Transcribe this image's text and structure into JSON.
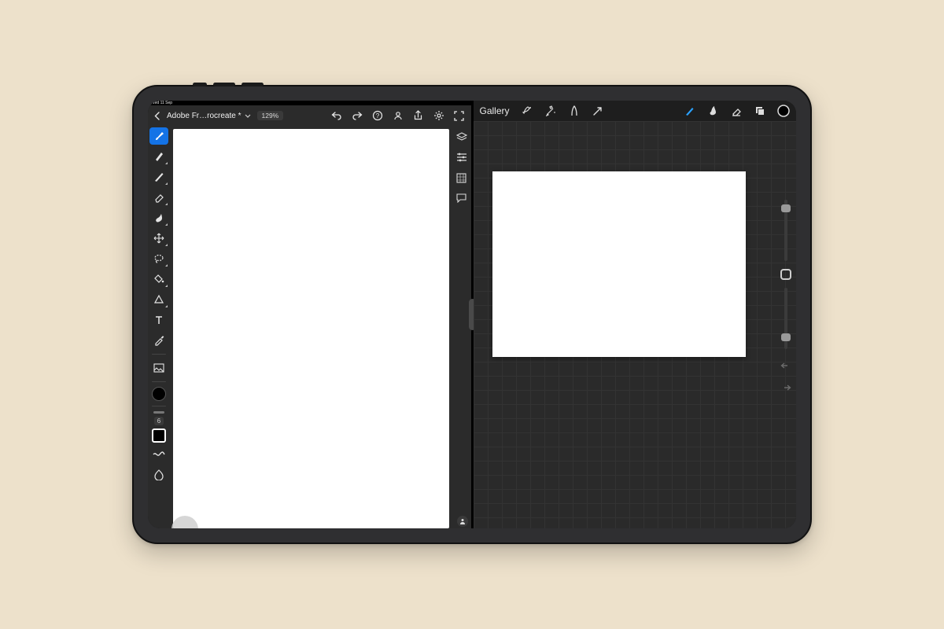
{
  "statusbar": {
    "text": "Wed 11 Sep"
  },
  "fresco": {
    "document_name": "Adobe Fr…rocreate *",
    "zoom": "129%",
    "tools": [
      {
        "id": "pixel-brush",
        "active": true,
        "hasSub": false
      },
      {
        "id": "live-brush",
        "active": false,
        "hasSub": true
      },
      {
        "id": "vector-brush",
        "active": false,
        "hasSub": true
      },
      {
        "id": "eraser",
        "active": false,
        "hasSub": true
      },
      {
        "id": "smudge",
        "active": false,
        "hasSub": true
      },
      {
        "id": "move",
        "active": false,
        "hasSub": true
      },
      {
        "id": "lasso",
        "active": false,
        "hasSub": true
      },
      {
        "id": "fill",
        "active": false,
        "hasSub": true
      },
      {
        "id": "shape",
        "active": false,
        "hasSub": true
      },
      {
        "id": "text",
        "active": false,
        "hasSub": false
      },
      {
        "id": "eyedropper",
        "active": false,
        "hasSub": false
      },
      {
        "id": "place-image",
        "active": false,
        "hasSub": false
      }
    ],
    "brush_size": "6",
    "foreground": "#000000",
    "right_panels": [
      "layers",
      "adjust",
      "precision",
      "comments"
    ],
    "top_actions": [
      "undo",
      "redo",
      "help",
      "invite",
      "share",
      "settings",
      "fullscreen"
    ]
  },
  "procreate": {
    "gallery_label": "Gallery",
    "top_left_actions": [
      "actions",
      "adjustments",
      "selection",
      "transform"
    ],
    "top_right_actions": [
      {
        "id": "brush",
        "active": true
      },
      {
        "id": "smudge",
        "active": false
      },
      {
        "id": "eraser",
        "active": false
      },
      {
        "id": "layers",
        "active": false
      },
      {
        "id": "color",
        "active": false
      }
    ],
    "color": "#000000"
  }
}
